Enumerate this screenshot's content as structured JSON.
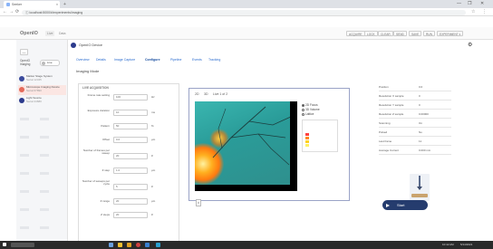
{
  "browser": {
    "tab_label": "Seeker",
    "new_tab": "+",
    "url": "ⓘ  localhost:5000/#/experiments/imaging",
    "win_controls": [
      "—",
      "❐",
      "✕"
    ]
  },
  "app": {
    "logo": "OpenIO",
    "header_tabs": [
      "Live",
      "Data"
    ],
    "right_buttons": [
      "ACQUIRE",
      "LOCK",
      "CLEAR",
      "SEND",
      "SAVE",
      "RUN",
      "EXPERIMENT ▾"
    ]
  },
  "sidebar": {
    "top_button": "—",
    "filter_label": "OpenIO Imaging",
    "filter_toggle": "Live",
    "devices": [
      {
        "line1": "Marker Stage System",
        "line2": "Serial 12345"
      },
      {
        "line1": "Microscope Imaging Device",
        "line2": "Serial 67890"
      },
      {
        "line1": "Light Source",
        "line2": "Serial 24680"
      }
    ]
  },
  "panel": {
    "device_title": "OpenIO Device",
    "nav_tabs": [
      "Overview",
      "Details",
      "Image Capture",
      "Configure",
      "Pipeline",
      "Events",
      "Tracking"
    ],
    "section_title": "Imaging Mode",
    "form": {
      "title": "LIVE ACQUISITION",
      "rows": [
        {
          "label": "Frame rate setting",
          "value": "100",
          "unit": "Hz"
        },
        {
          "label": "Exposure duration",
          "value": "10",
          "unit": "ms"
        },
        {
          "label": "Pattern",
          "value": "50",
          "unit": "%"
        },
        {
          "label": "Offset",
          "value": "0.0",
          "unit": "μm"
        },
        {
          "label": "Number of frames per sweep",
          "value": "20",
          "unit": "#"
        },
        {
          "label": "Z step",
          "value": "1.0",
          "unit": "μm"
        },
        {
          "label": "Number of sweeps per cycle",
          "value": "5",
          "unit": "#"
        },
        {
          "label": "Z range",
          "value": "20",
          "unit": "μm"
        },
        {
          "label": "Z steps",
          "value": "20",
          "unit": "#"
        }
      ]
    },
    "viewer": {
      "tabs": [
        "2D",
        "3D",
        "Live 1 of 2"
      ],
      "radios": [
        "2D Focus",
        "3D Volume",
        "Lattice"
      ],
      "control": "⇕"
    },
    "status": [
      {
        "label": "Position",
        "value": "0.0"
      },
      {
        "label": "Resolution X sample",
        "value": "0"
      },
      {
        "label": "Resolution Y sample",
        "value": "0"
      },
      {
        "label": "Resolution Z sample",
        "value": "0.00000"
      },
      {
        "label": "Scanning",
        "value": "On"
      },
      {
        "label": "Pulsed",
        "value": "No"
      },
      {
        "label": "Last frame",
        "value": "11"
      },
      {
        "label": "Average Current",
        "value": "0.000 mA"
      }
    ],
    "start_label": "Start"
  },
  "taskbar": {
    "time": "10:42 AM",
    "date": "5/14/2021"
  },
  "colors": {
    "accent_blue": "#2b6ccf",
    "dark_navy": "#253c6e",
    "neuron_orange": "#ff9a1a",
    "image_teal": "#2fa8a4"
  }
}
